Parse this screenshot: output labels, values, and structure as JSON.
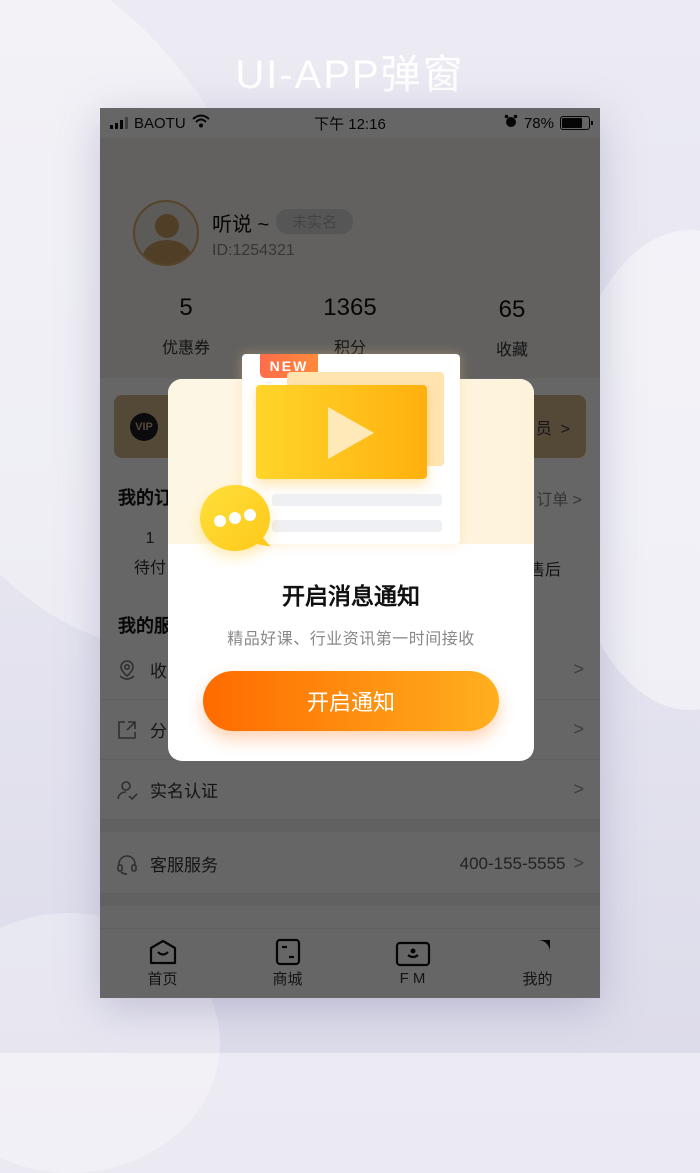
{
  "page_heading": "UI-APP弹窗",
  "status_bar": {
    "carrier": "BAOTU",
    "time": "下午 12:16",
    "battery_percent": "78%",
    "battery_level": 0.78
  },
  "profile": {
    "name": "听说 ~",
    "badge": "未实名",
    "id_label": "ID:1254321"
  },
  "stats": [
    {
      "value": "5",
      "label": "优惠券"
    },
    {
      "value": "1365",
      "label": "积分"
    },
    {
      "value": "65",
      "label": "收藏"
    }
  ],
  "vip_banner": {
    "icon_text": "VIP",
    "text_visible": "员",
    "chevron": ">"
  },
  "orders": {
    "title": "我的订",
    "more": "订单 >",
    "items": [
      {
        "count": "1",
        "label": "待付"
      },
      {
        "count": "",
        "label": "售后"
      }
    ]
  },
  "services": {
    "title": "我的服",
    "rows": [
      {
        "icon": "location-icon",
        "label": "收",
        "value": ""
      },
      {
        "icon": "share-icon",
        "label": "分",
        "value": ""
      },
      {
        "icon": "user-verify-icon",
        "label": "实名认证",
        "value": ""
      },
      {
        "icon": "headset-icon",
        "label": "客服服务",
        "value": "400-155-5555"
      }
    ],
    "chevron": ">"
  },
  "tabbar": [
    {
      "icon": "home-icon",
      "label": "首页"
    },
    {
      "icon": "shop-icon",
      "label": "商城"
    },
    {
      "icon": "fm-icon",
      "label": "F M"
    },
    {
      "icon": "profile-icon",
      "label": "我的"
    }
  ],
  "modal": {
    "tag": "NEW",
    "title": "开启消息通知",
    "subtitle": "精品好课、行业资讯第一时间接收",
    "button_label": "开启通知",
    "colors": {
      "button_start": "#ff6a00",
      "button_end": "#ffb01e",
      "video_start": "#ffd52a",
      "video_end": "#ffb00e",
      "tag": "#ff6c4a"
    }
  }
}
